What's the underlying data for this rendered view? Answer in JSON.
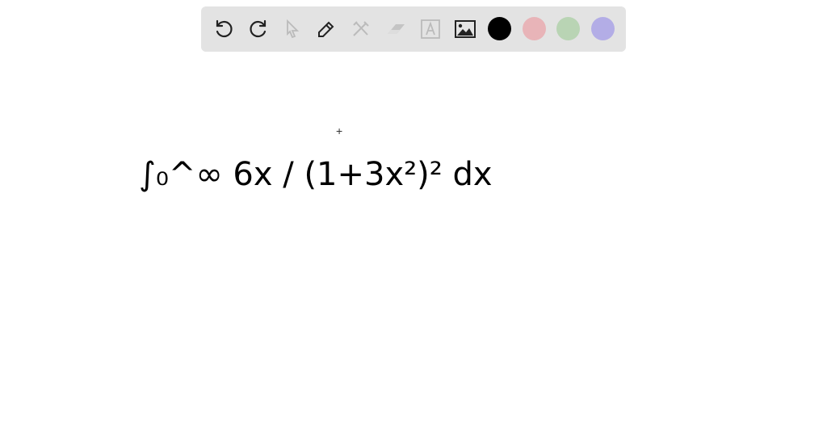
{
  "toolbar": {
    "tools": [
      {
        "name": "undo",
        "icon": "undo-icon",
        "enabled": true
      },
      {
        "name": "redo",
        "icon": "redo-icon",
        "enabled": true
      },
      {
        "name": "select",
        "icon": "pointer-icon",
        "enabled": false
      },
      {
        "name": "pen",
        "icon": "pencil-icon",
        "enabled": true
      },
      {
        "name": "tools",
        "icon": "tools-icon",
        "enabled": false
      },
      {
        "name": "eraser",
        "icon": "eraser-icon",
        "enabled": false
      },
      {
        "name": "text",
        "icon": "text-box-icon",
        "enabled": false
      },
      {
        "name": "image",
        "icon": "image-icon",
        "enabled": true
      }
    ],
    "colors": [
      "#000000",
      "#e8b4b8",
      "#b9d4b4",
      "#b3ade6"
    ],
    "selected_color": "#000000"
  },
  "canvas": {
    "handwriting_transcription": "∫₀^∞ 6x / (1+3x²)² dx"
  }
}
